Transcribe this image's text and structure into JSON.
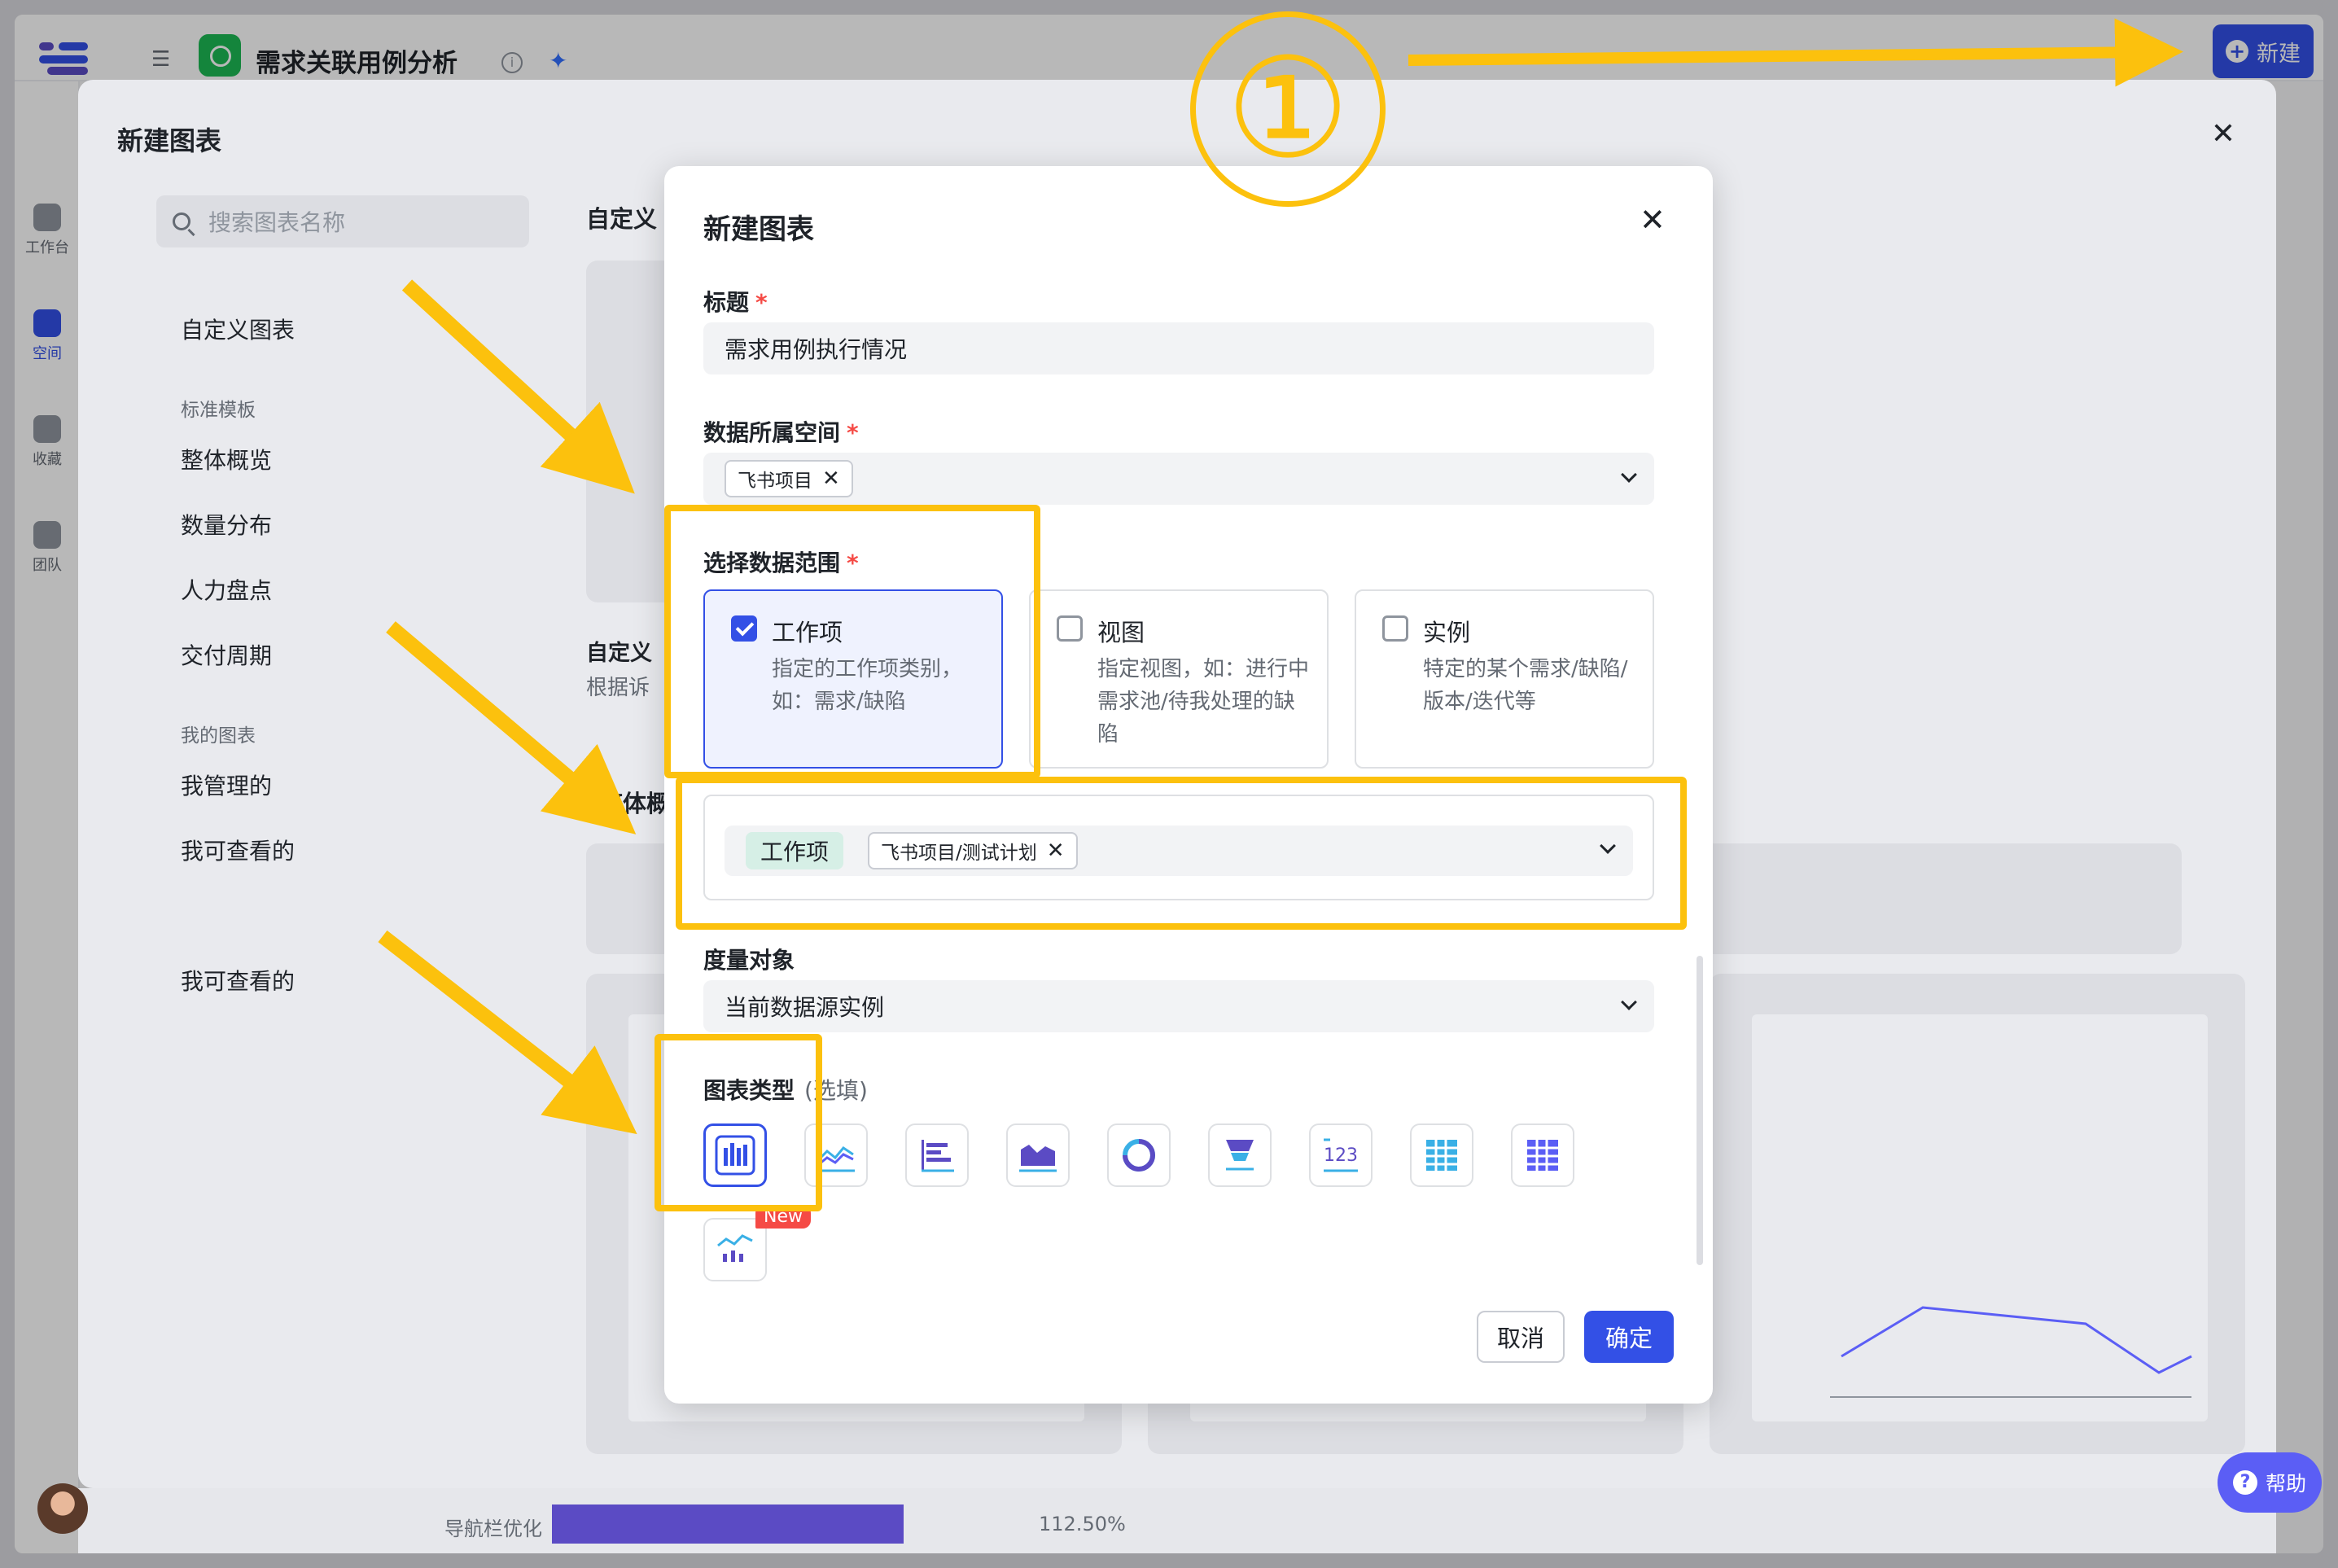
{
  "header": {
    "page_name": "需求关联用例分析",
    "new_button": "新建",
    "info_glyph": "i",
    "pin_glyph": "✦"
  },
  "rail": {
    "items": [
      "工作台",
      "空间",
      "收藏",
      "团队"
    ]
  },
  "outer_modal": {
    "title": "新建图表",
    "close": "✕",
    "search_placeholder": "搜索图表名称",
    "sidebar": {
      "custom": "自定义图表",
      "standard_group": "标准模板",
      "standard_items": [
        "整体概览",
        "数量分布",
        "人力盘点",
        "交付周期"
      ],
      "mine_group": "我的图表",
      "mine_items": [
        "我管理的",
        "我可查看的"
      ],
      "extra_item": "我可查看的"
    },
    "main": {
      "section_custom": "自定义",
      "custom_card_title": "自定义",
      "custom_card_desc": "根据诉",
      "section_overview": "整体概"
    }
  },
  "modal": {
    "title": "新建图表",
    "close": "✕",
    "title_label": "标题",
    "title_value": "需求用例执行情况",
    "space_label": "数据所属空间",
    "space_tag": "飞书项目",
    "scope_label": "选择数据范围",
    "scope_options": [
      {
        "title": "工作项",
        "desc": "指定的工作项类别，如：需求/缺陷",
        "checked": true
      },
      {
        "title": "视图",
        "desc": "指定视图，如：进行中需求池/待我处理的缺陷",
        "checked": false
      },
      {
        "title": "实例",
        "desc": "特定的某个需求/缺陷/版本/迭代等",
        "checked": false
      }
    ],
    "filter_tag": "工作项",
    "filter_value": "飞书项目/测试计划",
    "measure_label": "度量对象",
    "measure_value": "当前数据源实例",
    "chart_type_label": "图表类型",
    "chart_type_optional": "(选填)",
    "chart_types": [
      "bar-chart-icon",
      "line-chart-icon",
      "horizontal-bar-icon",
      "area-chart-icon",
      "donut-chart-icon",
      "funnel-chart-icon",
      "number-card-icon",
      "table-icon",
      "pivot-table-icon",
      "combo-chart-icon"
    ],
    "new_badge": "New",
    "required_mark": "*",
    "cancel": "取消",
    "confirm": "确定"
  },
  "bottom": {
    "progress_label": "导航栏优化",
    "progress_value": "112.50%",
    "progress_fraction": 0.36,
    "help": "帮助"
  },
  "annotation": {
    "step": "①"
  },
  "colors": {
    "accent": "#3350e6",
    "highlight": "#fcc10d",
    "required": "#f54a45",
    "progress": "#5b4bc4"
  }
}
